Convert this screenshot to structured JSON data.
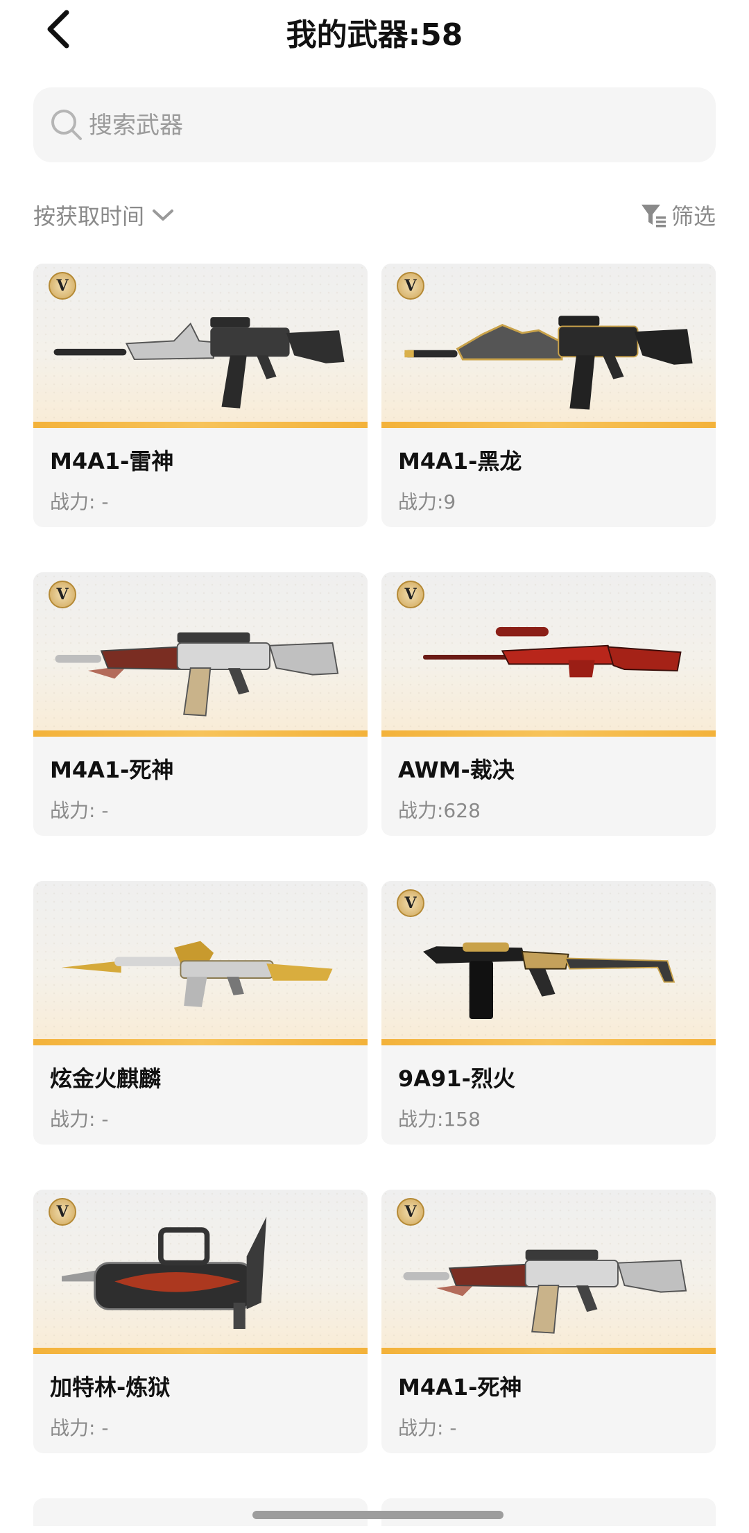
{
  "header": {
    "title": "我的武器:58",
    "back_icon": "chevron-left-icon"
  },
  "search": {
    "placeholder": "搜索武器",
    "value": "",
    "icon": "search-icon"
  },
  "sort": {
    "label": "按获取时间",
    "icon": "chevron-down-icon"
  },
  "filter": {
    "label": "筛选",
    "icon": "filter-icon"
  },
  "colors": {
    "accent_stripe": "#f3b23a",
    "card_bg": "#f5f5f5",
    "muted_text": "#8a8a8a"
  },
  "weapons": [
    {
      "name": "M4A1-雷神",
      "power": "战力: -",
      "badge": "V",
      "style": "silver"
    },
    {
      "name": "M4A1-黑龙",
      "power": "战力:9",
      "badge": "V",
      "style": "gold"
    },
    {
      "name": "M4A1-死神",
      "power": "战力: -",
      "badge": "V",
      "style": "reaper"
    },
    {
      "name": "AWM-裁决",
      "power": "战力:628",
      "badge": "V",
      "style": "red"
    },
    {
      "name": "炫金火麒麟",
      "power": "战力: -",
      "badge": "",
      "style": "goldak"
    },
    {
      "name": "9A91-烈火",
      "power": "战力:158",
      "badge": "V",
      "style": "smg"
    },
    {
      "name": "加特林-炼狱",
      "power": "战力: -",
      "badge": "V",
      "style": "gatling"
    },
    {
      "name": "M4A1-死神",
      "power": "战力: -",
      "badge": "V",
      "style": "reaper"
    }
  ]
}
